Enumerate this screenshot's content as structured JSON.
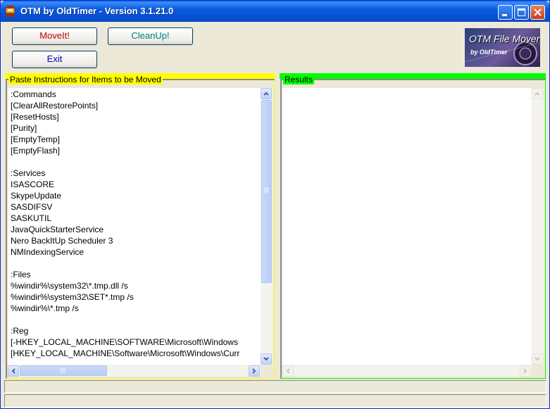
{
  "window": {
    "title": "OTM by OldTimer - Version 3.1.21.0",
    "app_icon": "otm-app-icon",
    "controls": [
      "minimize-icon",
      "maximize-icon",
      "close-icon"
    ]
  },
  "toolbar": {
    "moveit_label": "MoveIt!",
    "moveit_color": "#c00000",
    "cleanup_label": "CleanUp!",
    "cleanup_color": "#008080",
    "exit_label": "Exit",
    "exit_color": "#0000c0"
  },
  "logo": {
    "title": "OTM File Mover",
    "subtitle": "by OldTimer"
  },
  "instructions_pane": {
    "label": "Paste Instructions for Items to be Moved",
    "accent_color": "#ffff00",
    "lines": [
      ":Commands",
      "[ClearAllRestorePoints]",
      "[ResetHosts]",
      "[Purity]",
      "[EmptyTemp]",
      "[EmptyFlash]",
      "",
      ":Services",
      "ISASCORE",
      "SkypeUpdate",
      "SASDIFSV",
      "SASKUTIL",
      "JavaQuickStarterService",
      "Nero BackItUp Scheduler 3",
      "NMIndexingService",
      "",
      ":Files",
      "%windir%\\system32\\*.tmp.dll /s",
      "%windir%\\system32\\SET*.tmp /s",
      "%windir%\\*.tmp /s",
      "",
      ":Reg",
      "[-HKEY_LOCAL_MACHINE\\SOFTWARE\\Microsoft\\Windows",
      "[HKEY_LOCAL_MACHINE\\Software\\Microsoft\\Windows\\Curr"
    ]
  },
  "results_pane": {
    "label": "Results",
    "accent_color": "#00ff00",
    "lines": []
  },
  "status_bar": {
    "text": ""
  }
}
